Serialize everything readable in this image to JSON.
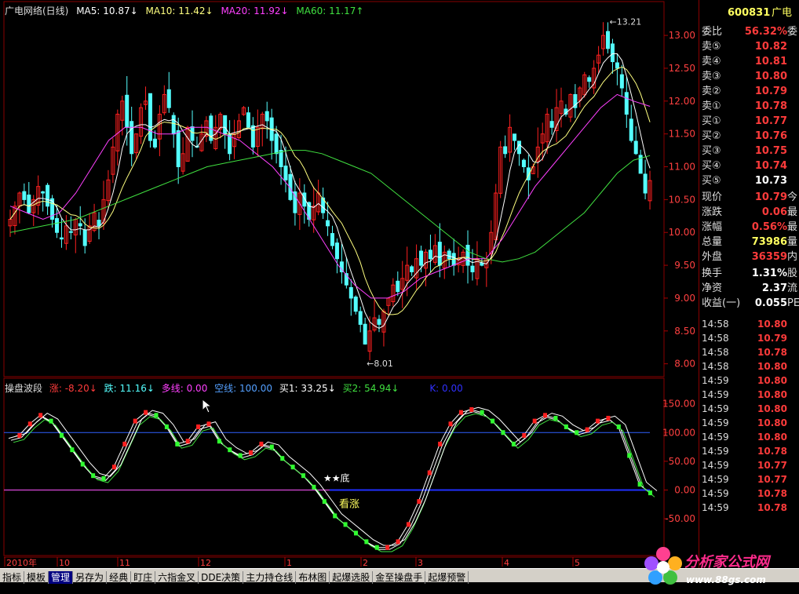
{
  "colors": {
    "up": "#ff2020",
    "down": "#54ffff",
    "ma5": "#ffffff",
    "ma10": "#ffff80",
    "ma20": "#ff40ff",
    "ma60": "#40e040"
  },
  "header": {
    "title": "广电网络(日线)",
    "ma5": "MA5: 10.87↓",
    "ma10": "MA10: 11.42↓",
    "ma20": "MA20: 11.92↓",
    "ma60": "MA60: 11.17↑"
  },
  "indicator_header": {
    "name": "操盘波段",
    "rise": "涨: -8.20↓",
    "fall": "跌: 11.16↓",
    "long": "多线: 0.00",
    "short": "空线: 100.00",
    "buy1": "买1: 33.25↓",
    "buy2": "买2: 54.94↓",
    "k": "K: 0.00"
  },
  "chart_data": [
    {
      "type": "candlestick",
      "title": "广电网络(日线)",
      "y_ticks": [
        "13.00",
        "12.50",
        "12.00",
        "11.50",
        "11.00",
        "10.50",
        "10.00",
        "9.50",
        "9.00",
        "8.50",
        "8.00"
      ],
      "ylim": [
        7.9,
        13.3
      ],
      "high_label": "13.21",
      "low_label": "8.01",
      "x_ticks": [
        "2010年",
        "10",
        "11",
        "12",
        "1",
        "2",
        "3",
        "4",
        "5"
      ],
      "close": [
        10.2,
        10.4,
        10.6,
        10.5,
        10.3,
        10.5,
        10.7,
        10.6,
        10.4,
        10.2,
        10.0,
        9.9,
        10.1,
        10.0,
        10.2,
        10.1,
        9.8,
        10.1,
        10.3,
        10.1,
        10.5,
        10.8,
        11.3,
        11.8,
        12.0,
        11.6,
        11.2,
        11.5,
        11.9,
        12.0,
        11.4,
        11.3,
        11.8,
        12.1,
        11.9,
        11.5,
        11.0,
        11.2,
        11.6,
        11.4,
        11.3,
        11.5,
        11.7,
        11.4,
        11.6,
        11.8,
        11.5,
        11.2,
        11.5,
        11.7,
        11.9,
        11.6,
        11.3,
        11.6,
        11.8,
        11.7,
        11.4,
        11.2,
        11.0,
        10.8,
        10.5,
        10.3,
        10.6,
        10.4,
        10.2,
        10.4,
        10.6,
        10.3,
        10.1,
        9.8,
        9.6,
        9.4,
        9.2,
        9.0,
        8.8,
        8.6,
        8.3,
        8.5,
        8.7,
        8.6,
        8.8,
        9.0,
        9.2,
        9.1,
        9.3,
        9.5,
        9.4,
        9.6,
        9.5,
        9.7,
        9.6,
        9.8,
        9.5,
        9.7,
        9.6,
        9.5,
        9.6,
        9.7,
        9.5,
        9.4,
        9.6,
        9.5,
        9.6,
        10.0,
        10.6,
        11.3,
        11.2,
        11.6,
        11.4,
        11.2,
        11.0,
        10.8,
        11.0,
        11.3,
        11.5,
        11.8,
        11.6,
        11.9,
        12.0,
        11.8,
        12.1,
        11.9,
        12.2,
        12.4,
        12.3,
        12.5,
        12.7,
        13.0,
        12.8,
        12.6,
        12.5,
        12.2,
        11.8,
        11.4,
        11.2,
        10.9,
        10.6,
        10.79
      ],
      "ma60": [
        10.0,
        10.05,
        10.1,
        10.15,
        10.2,
        10.3,
        10.4,
        10.5,
        10.6,
        10.7,
        10.8,
        10.9,
        11.0,
        11.05,
        11.1,
        11.15,
        11.2,
        11.25,
        11.25,
        11.2,
        11.1,
        11.0,
        10.9,
        10.7,
        10.5,
        10.3,
        10.1,
        9.9,
        9.7,
        9.6,
        9.55,
        9.6,
        9.7,
        9.9,
        10.1,
        10.3,
        10.6,
        10.9,
        11.1,
        11.17
      ],
      "ma20": [
        10.4,
        10.3,
        10.2,
        10.3,
        10.6,
        11.0,
        11.4,
        11.6,
        11.6,
        11.5,
        11.5,
        11.6,
        11.6,
        11.5,
        11.4,
        11.2,
        11.0,
        10.7,
        10.3,
        9.9,
        9.5,
        9.2,
        9.0,
        9.0,
        9.1,
        9.3,
        9.4,
        9.5,
        9.6,
        9.6,
        9.9,
        10.3,
        10.7,
        11.0,
        11.3,
        11.6,
        11.9,
        12.1,
        12.0,
        11.92
      ]
    },
    {
      "type": "line",
      "title": "操盘波段",
      "y_ticks": [
        "150.00",
        "100.00",
        "50.00",
        "0.00",
        "-50.00"
      ],
      "ylim": [
        -110,
        170
      ],
      "hlines": [
        100,
        0
      ],
      "wave": [
        90,
        95,
        115,
        130,
        120,
        95,
        70,
        45,
        25,
        20,
        40,
        80,
        120,
        135,
        130,
        110,
        80,
        85,
        110,
        115,
        85,
        70,
        60,
        65,
        80,
        75,
        55,
        40,
        25,
        5,
        -20,
        -45,
        -60,
        -75,
        -90,
        -100,
        -100,
        -90,
        -60,
        -20,
        30,
        80,
        115,
        135,
        140,
        135,
        120,
        100,
        80,
        95,
        120,
        130,
        125,
        110,
        100,
        105,
        120,
        125,
        110,
        60,
        10,
        -5
      ],
      "annotations": [
        "★★底",
        "看涨"
      ]
    }
  ],
  "quote": {
    "code": "600831",
    "name": "广电",
    "rows": [
      {
        "label": "委比",
        "value": "56.32%",
        "extra": "委",
        "color": "#ff3b3b"
      },
      {
        "label": "卖⑤",
        "value": "10.82",
        "extra": "",
        "color": "#ff3b3b"
      },
      {
        "label": "卖④",
        "value": "10.81",
        "extra": "",
        "color": "#ff3b3b"
      },
      {
        "label": "卖③",
        "value": "10.80",
        "extra": "",
        "color": "#ff3b3b"
      },
      {
        "label": "卖②",
        "value": "10.79",
        "extra": "",
        "color": "#ff3b3b"
      },
      {
        "label": "卖①",
        "value": "10.78",
        "extra": "",
        "color": "#ff3b3b"
      },
      {
        "label": "买①",
        "value": "10.77",
        "extra": "",
        "color": "#ff3b3b"
      },
      {
        "label": "买②",
        "value": "10.76",
        "extra": "",
        "color": "#ff3b3b"
      },
      {
        "label": "买③",
        "value": "10.75",
        "extra": "",
        "color": "#ff3b3b"
      },
      {
        "label": "买④",
        "value": "10.74",
        "extra": "",
        "color": "#ff3b3b"
      },
      {
        "label": "买⑤",
        "value": "10.73",
        "extra": "",
        "color": "#ffffff"
      },
      {
        "label": "现价",
        "value": "10.79",
        "extra": "今",
        "color": "#ff3b3b"
      },
      {
        "label": "涨跌",
        "value": "0.06",
        "extra": "最",
        "color": "#ff3b3b"
      },
      {
        "label": "涨幅",
        "value": "0.56%",
        "extra": "最",
        "color": "#ff3b3b"
      },
      {
        "label": "总量",
        "value": "73986",
        "extra": "量",
        "color": "#ffff60"
      },
      {
        "label": "外盘",
        "value": "36359",
        "extra": "内",
        "color": "#ff3b3b"
      },
      {
        "label": "换手",
        "value": "1.31%",
        "extra": "股",
        "color": "#ffffff"
      },
      {
        "label": "净资",
        "value": "2.37",
        "extra": "流",
        "color": "#ffffff"
      },
      {
        "label": "收益(一)",
        "value": "0.055",
        "extra": "PE",
        "color": "#ffffff"
      }
    ],
    "ticks": [
      {
        "t": "14:58",
        "p": "10.80"
      },
      {
        "t": "14:58",
        "p": "10.79"
      },
      {
        "t": "14:58",
        "p": "10.78"
      },
      {
        "t": "14:58",
        "p": "10.80"
      },
      {
        "t": "14:59",
        "p": "10.80"
      },
      {
        "t": "14:59",
        "p": "10.80"
      },
      {
        "t": "14:59",
        "p": "10.80"
      },
      {
        "t": "14:59",
        "p": "10.80"
      },
      {
        "t": "14:59",
        "p": "10.80"
      },
      {
        "t": "14:59",
        "p": "10.78"
      },
      {
        "t": "14:59",
        "p": "10.77"
      },
      {
        "t": "14:59",
        "p": "10.77"
      },
      {
        "t": "14:59",
        "p": "10.78"
      },
      {
        "t": "14:59",
        "p": "10.78"
      }
    ]
  },
  "tabs": [
    "指标",
    "模板",
    "管理",
    "另存为",
    "经典",
    "盯庄",
    "六指金叉",
    "DDE决策",
    "主力持仓线",
    "布林图",
    "起爆选股",
    "金至操盘手",
    "起爆预警"
  ],
  "active_tab": 2,
  "logo": {
    "name": "分析家公式网",
    "url": "www.88gs.com"
  }
}
